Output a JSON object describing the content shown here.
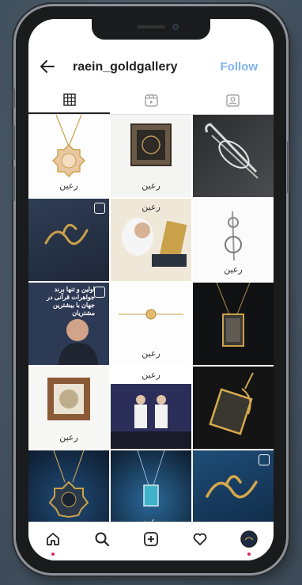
{
  "profile": {
    "username": "raein_goldgallery",
    "follow_label": "Follow"
  },
  "tabs": [
    {
      "icon": "grid-icon",
      "active": true
    },
    {
      "icon": "reels-icon",
      "active": false
    },
    {
      "icon": "tagged-icon",
      "active": false
    }
  ],
  "posts": [
    {
      "title": "",
      "kind": "gold-pendant-white"
    },
    {
      "title": "",
      "kind": "framed-plaque"
    },
    {
      "title": "",
      "kind": "pin-dark"
    },
    {
      "title": "",
      "kind": "logo-reel",
      "badge": "reel"
    },
    {
      "title": "",
      "kind": "man-crown"
    },
    {
      "title": "",
      "kind": "pin-white"
    },
    {
      "title": "اولین و تنها برند جواهرات قرآنی در جهان با بیشترین مشتریان",
      "kind": "text-portrait",
      "badge": "carousel"
    },
    {
      "title": "",
      "kind": "bracelet-white"
    },
    {
      "title": "",
      "kind": "pendant-dark"
    },
    {
      "title": "",
      "kind": "framed-wood"
    },
    {
      "title": "",
      "kind": "award"
    },
    {
      "title": "",
      "kind": "pin-gold"
    },
    {
      "title": "",
      "kind": "pendant-blue"
    },
    {
      "title": "",
      "kind": "pendant-blue2"
    },
    {
      "title": "",
      "kind": "logo-blue",
      "badge": "carousel"
    }
  ],
  "brand_mark": "رعین",
  "nav": [
    {
      "icon": "home-icon",
      "active": true
    },
    {
      "icon": "search-icon"
    },
    {
      "icon": "create-icon"
    },
    {
      "icon": "heart-icon"
    },
    {
      "icon": "profile-avatar"
    }
  ],
  "colors": {
    "follow": "#7fb3f0",
    "gold": "#c9a14a"
  }
}
